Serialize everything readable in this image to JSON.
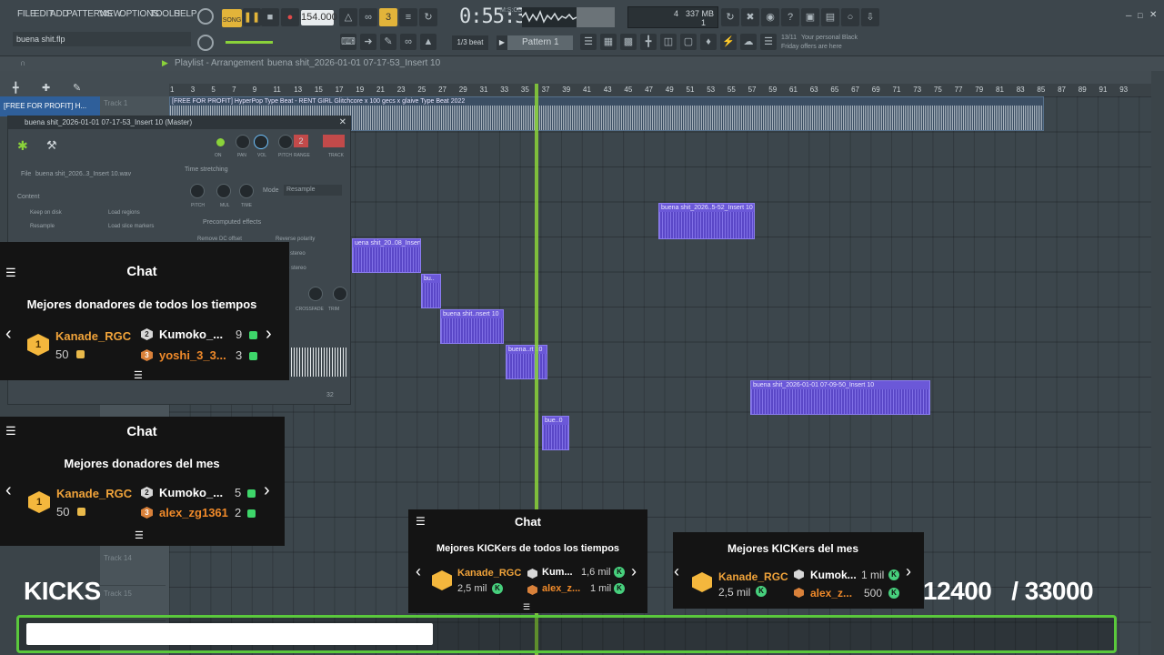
{
  "menu": [
    "FILE",
    "EDIT",
    "ADD",
    "PATTERNS",
    "VIEW",
    "OPTIONS",
    "TOOLS",
    "HELP"
  ],
  "file_name": "buena shit.flp",
  "mode_song": "SONG",
  "bpm": "154.000",
  "time": "0:55:36",
  "time_unit": "M:S:CS",
  "cpu_num": "4",
  "mem": "337 MB",
  "mem_sub": "1",
  "snap": "1/3 beat",
  "pattern": "Pattern 1",
  "news": {
    "count": "13/11",
    "line1": "Your personal Black",
    "line2": "Friday offers are here"
  },
  "playlist": {
    "title": "Playlist - Arrangement",
    "breadcrumb": "buena shit_2026-01-01 07-17-53_Insert 10"
  },
  "ruler": [
    "1",
    "3",
    "5",
    "7",
    "9",
    "11",
    "13",
    "15",
    "17",
    "19",
    "21",
    "23",
    "25",
    "27",
    "29",
    "31",
    "33",
    "35",
    "37",
    "39",
    "41",
    "43",
    "45",
    "47",
    "49",
    "51",
    "53",
    "55",
    "57",
    "59",
    "61",
    "63",
    "65",
    "67",
    "69",
    "71",
    "73",
    "75",
    "77",
    "79",
    "81",
    "83",
    "85",
    "87",
    "89",
    "91",
    "93"
  ],
  "tracks": {
    "t1": "Track 1",
    "t14": "Track 14",
    "t15": "Track 15",
    "top_clip_name": "[FREE FOR PROFIT] H..."
  },
  "clips": {
    "top": "[FREE FOR PROFIT] HyperPop Type Beat - RENT GIRL  Glitchcore x 100 gecs x glaive Type Beat 2022",
    "c1": "buena shit_2026..5-52_Insert 10",
    "c2": "uena shit_20..08_Insert 10",
    "c3": "bu..",
    "c4": "buena shit..nsert 10",
    "c5": "buena..rt 10",
    "c6": "bue..0",
    "c7": "buena shit_2026-01-01 07-09-50_Insert 10"
  },
  "channel": {
    "title": "buena shit_2026-01-01 07-17-53_Insert 10 (Master)",
    "file_label": "File",
    "file_value": "buena shit_2026..3_Insert 10.wav",
    "knobs": [
      "ON",
      "PAN",
      "VOL",
      "PITCH",
      "RANGE",
      "TRACK"
    ],
    "range_val": "2",
    "time_stretching": "Time stretching",
    "ts_knobs": [
      "PITCH",
      "MUL",
      "TIME"
    ],
    "mode_label": "Mode",
    "mode_value": "Resample",
    "content": "Content",
    "keep_on_disk": "Keep on disk",
    "resample": "Resample",
    "load_regions": "Load regions",
    "load_slice": "Load slice markers",
    "precomputed": "Precomputed effects",
    "remove_dc": "Remove DC offset",
    "reverse_polarity": "Reverse polarity",
    "stereo1": "stereo",
    "stereo2": "o stereo",
    "crossfade": "CROSSFADE",
    "trim": "TRIM",
    "corner": "32"
  },
  "chat1": {
    "header": "Chat",
    "title": "Mejores donadores de todos los tiempos",
    "rank1": {
      "name": "Kanade_RGC",
      "amount": "50",
      "rank": "1"
    },
    "rank2": {
      "name": "Kumoko_...",
      "amount": "9",
      "rank": "2"
    },
    "rank3": {
      "name": "yoshi_3_3...",
      "amount": "3",
      "rank": "3"
    }
  },
  "chat2": {
    "header": "Chat",
    "title": "Mejores donadores del mes",
    "rank1": {
      "name": "Kanade_RGC",
      "amount": "50",
      "rank": "1"
    },
    "rank2": {
      "name": "Kumoko_...",
      "amount": "5",
      "rank": "2"
    },
    "rank3": {
      "name": "alex_zg1361",
      "amount": "2",
      "rank": "3"
    }
  },
  "kick1": {
    "header": "Chat",
    "title": "Mejores KICKers de todos los tiempos",
    "rank1": {
      "name": "Kanade_RGC",
      "amount": "2,5 mil"
    },
    "rank2": {
      "name": "Kum...",
      "amount": "1,6 mil"
    },
    "rank3": {
      "name": "alex_z...",
      "amount": "1 mil"
    }
  },
  "kick2": {
    "title": "Mejores KICKers del mes",
    "rank1": {
      "name": "Kanade_RGC",
      "amount": "2,5 mil"
    },
    "rank2": {
      "name": "Kumok...",
      "amount": "1 mil"
    },
    "rank3": {
      "name": "alex_z...",
      "amount": "500"
    }
  },
  "kicks_goal": {
    "label": "KICKS",
    "count": "12400   / 33000",
    "progress": 0.376
  },
  "colors": {
    "accent_green": "#5ac83c",
    "clip_purple": "#5a47c7",
    "badge_gold": "#f4b73d"
  }
}
